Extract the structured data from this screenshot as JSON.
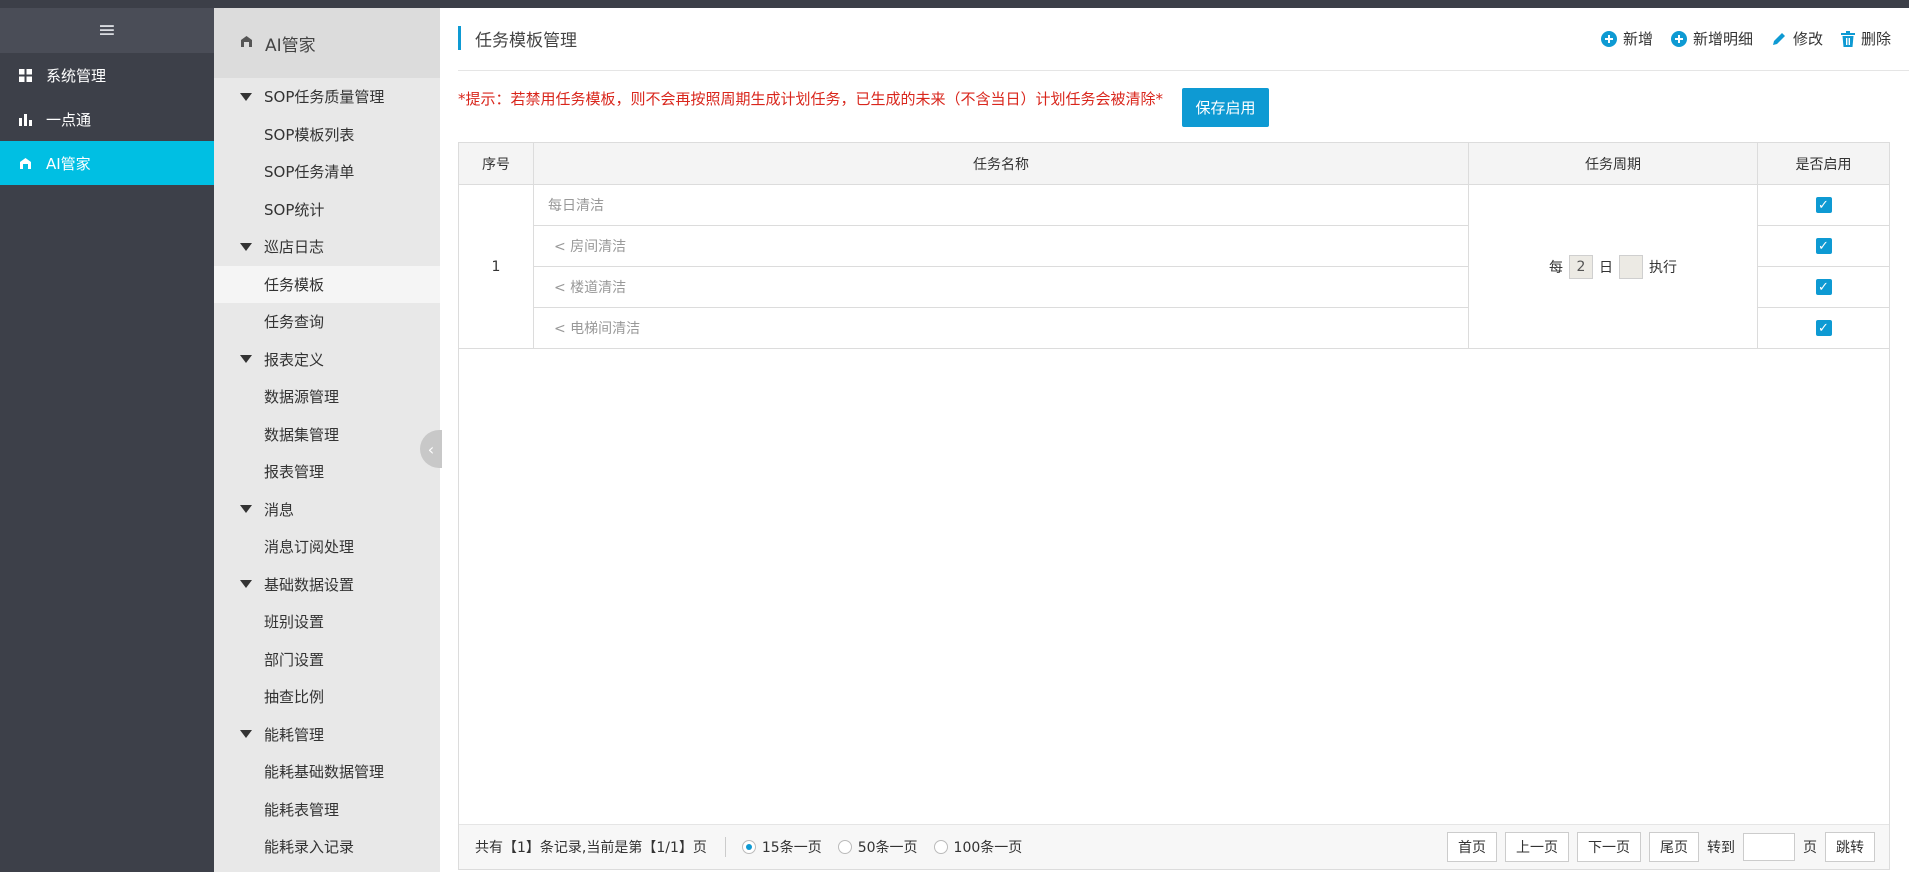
{
  "leftnav": {
    "items": [
      {
        "label": "系统管理",
        "icon": "grid-icon"
      },
      {
        "label": "一点通",
        "icon": "bar-chart-icon"
      },
      {
        "label": "AI管家",
        "icon": "butler-icon",
        "active": true
      }
    ]
  },
  "submenu": {
    "title": "AI管家",
    "groups": [
      {
        "label": "SOP任务质量管理",
        "items": [
          "SOP模板列表",
          "SOP任务清单",
          "SOP统计"
        ]
      },
      {
        "label": "巡店日志",
        "items": [
          "任务模板",
          "任务查询"
        ]
      },
      {
        "label": "报表定义",
        "items": [
          "数据源管理",
          "数据集管理",
          "报表管理"
        ]
      },
      {
        "label": "消息",
        "items": [
          "消息订阅处理"
        ]
      },
      {
        "label": "基础数据设置",
        "items": [
          "班别设置",
          "部门设置",
          "抽查比例"
        ]
      },
      {
        "label": "能耗管理",
        "items": [
          "能耗基础数据管理",
          "能耗表管理",
          "能耗录入记录"
        ]
      }
    ],
    "active": "任务模板"
  },
  "page": {
    "title": "任务模板管理",
    "toolbar": {
      "add": "新增",
      "add_detail": "新增明细",
      "edit": "修改",
      "delete": "删除"
    },
    "tip": "*提示：若禁用任务模板，则不会再按照周期生成计划任务，已生成的未来（不含当日）计划任务会被清除*",
    "save_label": "保存启用"
  },
  "table": {
    "headers": {
      "seq": "序号",
      "name": "任务名称",
      "cycle": "任务周期",
      "enabled": "是否启用"
    },
    "row": {
      "seq": "1",
      "names": [
        "每日清洁",
        "< 房间清洁",
        "< 楼道清洁",
        "< 电梯间清洁"
      ],
      "cycle": {
        "prefix": "每",
        "value": "2",
        "unit": "日",
        "exec": "执行"
      },
      "enabled": [
        true,
        true,
        true,
        true
      ]
    }
  },
  "pager": {
    "info": "共有【1】条记录,当前是第【1/1】页",
    "sizes": [
      {
        "label": "15条一页",
        "selected": true
      },
      {
        "label": "50条一页",
        "selected": false
      },
      {
        "label": "100条一页",
        "selected": false
      }
    ],
    "first": "首页",
    "prev": "上一页",
    "next": "下一页",
    "last": "尾页",
    "goto": "转到",
    "page_unit": "页",
    "jump": "跳转"
  },
  "colors": {
    "accent": "#0e9ad3",
    "nav_active": "#00bfe3",
    "tip": "#d9261c"
  }
}
